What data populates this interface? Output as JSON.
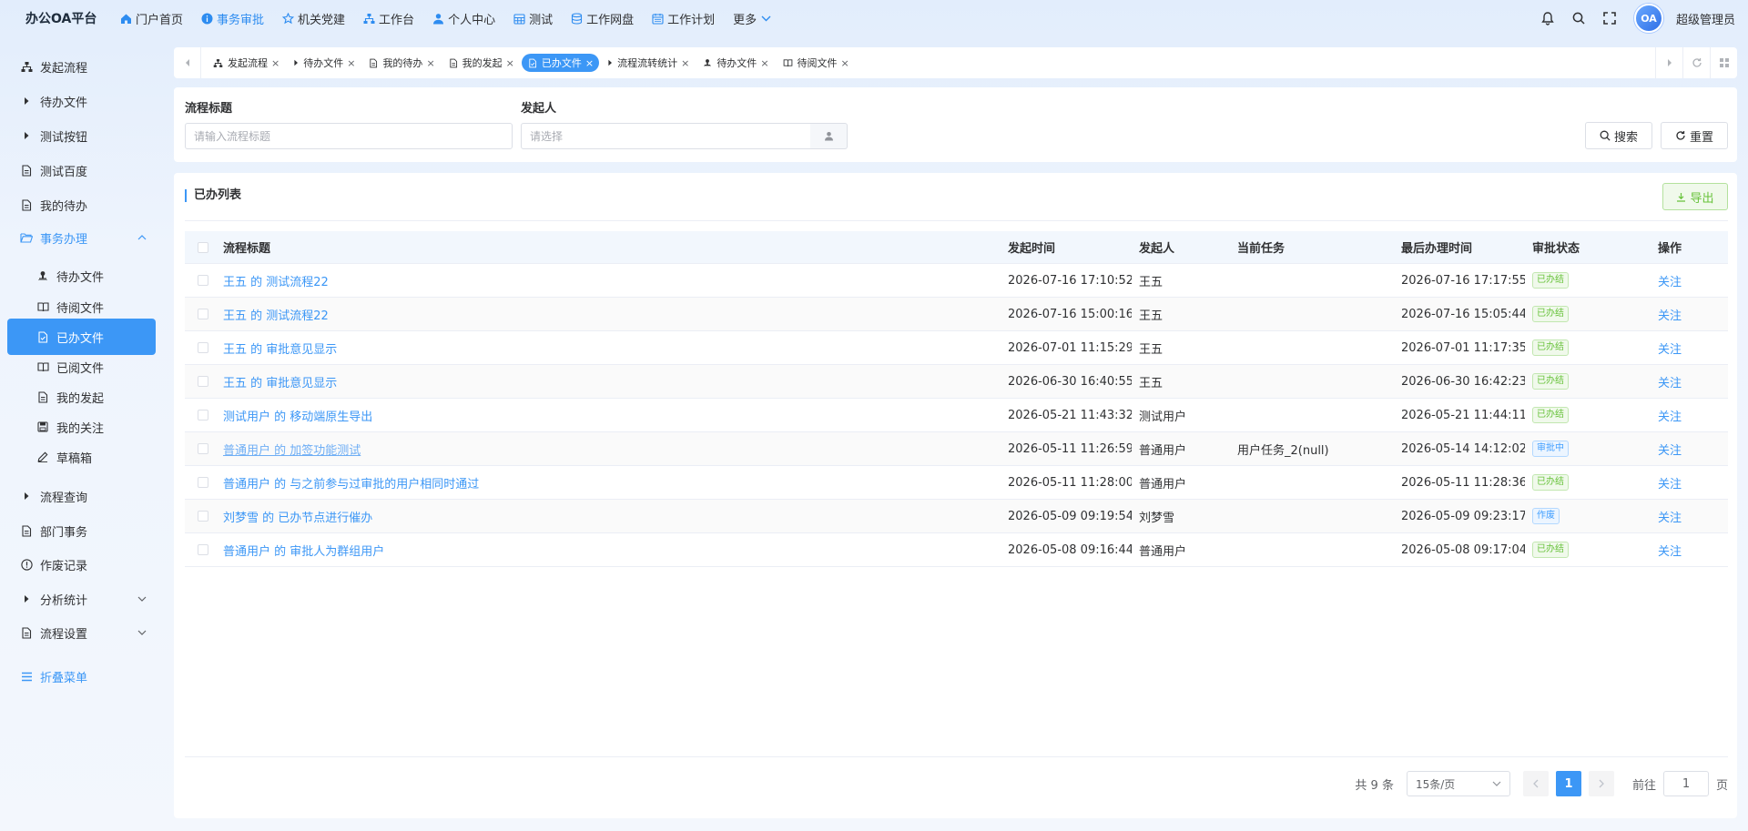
{
  "brand": "办公OA平台",
  "topnav": [
    {
      "label": "门户首页",
      "icon": "home-icon",
      "active": false
    },
    {
      "label": "事务审批",
      "icon": "info-circle-icon",
      "active": true
    },
    {
      "label": "机关党建",
      "icon": "star-icon",
      "active": false
    },
    {
      "label": "工作台",
      "icon": "sitemap-icon",
      "active": false
    },
    {
      "label": "个人中心",
      "icon": "user-icon",
      "active": false
    },
    {
      "label": "测试",
      "icon": "calendar-grid-icon",
      "active": false
    },
    {
      "label": "工作网盘",
      "icon": "database-icon",
      "active": false
    },
    {
      "label": "工作计划",
      "icon": "calendar-icon",
      "active": false
    },
    {
      "label": "更多",
      "icon": "chevron-down-icon",
      "active": false
    }
  ],
  "user": {
    "avatar_text": "OA",
    "name": "超级管理员"
  },
  "sidebar": {
    "items": [
      {
        "label": "发起流程",
        "icon": "sitemap-icon",
        "kind": "top"
      },
      {
        "label": "待办文件",
        "icon": "caret-right-icon",
        "kind": "top"
      },
      {
        "label": "测试按钮",
        "icon": "caret-right-icon",
        "kind": "top"
      },
      {
        "label": "测试百度",
        "icon": "document-icon",
        "kind": "top"
      },
      {
        "label": "我的待办",
        "icon": "document-icon",
        "kind": "top"
      },
      {
        "label": "事务办理",
        "icon": "folder-open-icon",
        "kind": "group-open"
      },
      {
        "label": "待办文件",
        "icon": "user-stamp-icon",
        "kind": "sub"
      },
      {
        "label": "待阅文件",
        "icon": "book-open-icon",
        "kind": "sub"
      },
      {
        "label": "已办文件",
        "icon": "document-check-icon",
        "kind": "sub-active"
      },
      {
        "label": "已阅文件",
        "icon": "book-open-icon",
        "kind": "sub"
      },
      {
        "label": "我的发起",
        "icon": "document-icon",
        "kind": "sub"
      },
      {
        "label": "我的关注",
        "icon": "save-icon",
        "kind": "sub"
      },
      {
        "label": "草稿箱",
        "icon": "pen-icon",
        "kind": "sub"
      },
      {
        "label": "流程查询",
        "icon": "caret-right-icon",
        "kind": "top"
      },
      {
        "label": "部门事务",
        "icon": "document-icon",
        "kind": "top"
      },
      {
        "label": "作废记录",
        "icon": "warning-circle-icon",
        "kind": "top"
      },
      {
        "label": "分析统计",
        "icon": "caret-right-icon",
        "kind": "top-expand"
      },
      {
        "label": "流程设置",
        "icon": "document-icon",
        "kind": "top-expand"
      }
    ],
    "collapse_label": "折叠菜单"
  },
  "tabs": [
    {
      "label": "发起流程",
      "icon": "sitemap-icon",
      "active": false
    },
    {
      "label": "待办文件",
      "icon": "caret-right-icon",
      "active": false
    },
    {
      "label": "我的待办",
      "icon": "document-icon",
      "active": false
    },
    {
      "label": "我的发起",
      "icon": "document-icon",
      "active": false
    },
    {
      "label": "已办文件",
      "icon": "document-check-icon",
      "active": true
    },
    {
      "label": "流程流转统计",
      "icon": "caret-right-icon",
      "active": false
    },
    {
      "label": "待办文件",
      "icon": "user-stamp-icon",
      "active": false
    },
    {
      "label": "待阅文件",
      "icon": "book-open-icon",
      "active": false
    }
  ],
  "search": {
    "title_label": "流程标题",
    "title_placeholder": "请输入流程标题",
    "initiator_label": "发起人",
    "initiator_placeholder": "请选择",
    "search_button": "搜索",
    "reset_button": "重置"
  },
  "list": {
    "title": "已办列表",
    "export_button": "导出",
    "columns": [
      "流程标题",
      "发起时间",
      "发起人",
      "当前任务",
      "最后办理时间",
      "审批状态",
      "操作"
    ],
    "rows": [
      {
        "title": "王五 的 测试流程22",
        "start": "2026-07-16 17:10:52",
        "initiator": "王五",
        "task": "",
        "last": "2026-07-16 17:17:55",
        "status": "已办结",
        "status_kind": "done",
        "op": "关注",
        "underline": false
      },
      {
        "title": "王五 的 测试流程22",
        "start": "2026-07-16 15:00:16",
        "initiator": "王五",
        "task": "",
        "last": "2026-07-16 15:05:44",
        "status": "已办结",
        "status_kind": "done",
        "op": "关注",
        "underline": false
      },
      {
        "title": "王五 的 审批意见显示",
        "start": "2026-07-01 11:15:29",
        "initiator": "王五",
        "task": "",
        "last": "2026-07-01 11:17:35",
        "status": "已办结",
        "status_kind": "done",
        "op": "关注",
        "underline": false
      },
      {
        "title": "王五 的 审批意见显示",
        "start": "2026-06-30 16:40:55",
        "initiator": "王五",
        "task": "",
        "last": "2026-06-30 16:42:23",
        "status": "已办结",
        "status_kind": "done",
        "op": "关注",
        "underline": false
      },
      {
        "title": "测试用户 的 移动端原生导出",
        "start": "2026-05-21 11:43:32",
        "initiator": "测试用户",
        "task": "",
        "last": "2026-05-21 11:44:11",
        "status": "已办结",
        "status_kind": "done",
        "op": "关注",
        "underline": false
      },
      {
        "title": "普通用户 的 加签功能测试",
        "start": "2026-05-11 11:26:59",
        "initiator": "普通用户",
        "task": "用户任务_2(null)",
        "last": "2026-05-14 14:12:02",
        "status": "审批中",
        "status_kind": "pending",
        "op": "关注",
        "underline": true
      },
      {
        "title": "普通用户 的 与之前参与过审批的用户相同时通过",
        "start": "2026-05-11 11:28:00",
        "initiator": "普通用户",
        "task": "",
        "last": "2026-05-11 11:28:36",
        "status": "已办结",
        "status_kind": "done",
        "op": "关注",
        "underline": false
      },
      {
        "title": "刘梦雪 的 已办节点进行催办",
        "start": "2026-05-09 09:19:54",
        "initiator": "刘梦雪",
        "task": "",
        "last": "2026-05-09 09:23:17",
        "status": "作废",
        "status_kind": "void",
        "op": "关注",
        "underline": false
      },
      {
        "title": "普通用户 的 审批人为群组用户",
        "start": "2026-05-08 09:16:44",
        "initiator": "普通用户",
        "task": "",
        "last": "2026-05-08 09:17:04",
        "status": "已办结",
        "status_kind": "done",
        "op": "关注",
        "underline": false
      }
    ]
  },
  "pagination": {
    "total_text": "共 9 条",
    "page_size": "15条/页",
    "current_page": "1",
    "goto_label": "前往",
    "goto_value": "1",
    "page_suffix": "页"
  },
  "colors": {
    "accent": "#3c97f6",
    "success": "#67c23a"
  }
}
